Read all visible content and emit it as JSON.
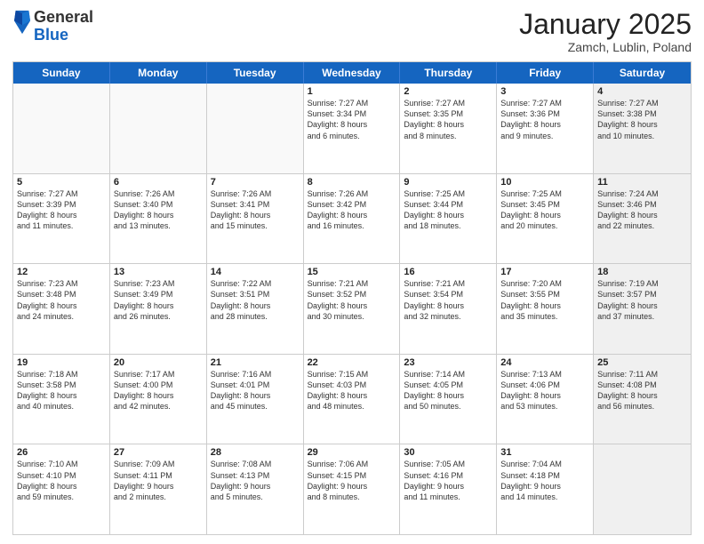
{
  "logo": {
    "general": "General",
    "blue": "Blue"
  },
  "title": "January 2025",
  "subtitle": "Zamch, Lublin, Poland",
  "headers": [
    "Sunday",
    "Monday",
    "Tuesday",
    "Wednesday",
    "Thursday",
    "Friday",
    "Saturday"
  ],
  "weeks": [
    [
      {
        "day": "",
        "info": "",
        "empty": true
      },
      {
        "day": "",
        "info": "",
        "empty": true
      },
      {
        "day": "",
        "info": "",
        "empty": true
      },
      {
        "day": "1",
        "info": "Sunrise: 7:27 AM\nSunset: 3:34 PM\nDaylight: 8 hours\nand 6 minutes."
      },
      {
        "day": "2",
        "info": "Sunrise: 7:27 AM\nSunset: 3:35 PM\nDaylight: 8 hours\nand 8 minutes."
      },
      {
        "day": "3",
        "info": "Sunrise: 7:27 AM\nSunset: 3:36 PM\nDaylight: 8 hours\nand 9 minutes."
      },
      {
        "day": "4",
        "info": "Sunrise: 7:27 AM\nSunset: 3:38 PM\nDaylight: 8 hours\nand 10 minutes.",
        "shaded": true
      }
    ],
    [
      {
        "day": "5",
        "info": "Sunrise: 7:27 AM\nSunset: 3:39 PM\nDaylight: 8 hours\nand 11 minutes."
      },
      {
        "day": "6",
        "info": "Sunrise: 7:26 AM\nSunset: 3:40 PM\nDaylight: 8 hours\nand 13 minutes."
      },
      {
        "day": "7",
        "info": "Sunrise: 7:26 AM\nSunset: 3:41 PM\nDaylight: 8 hours\nand 15 minutes."
      },
      {
        "day": "8",
        "info": "Sunrise: 7:26 AM\nSunset: 3:42 PM\nDaylight: 8 hours\nand 16 minutes."
      },
      {
        "day": "9",
        "info": "Sunrise: 7:25 AM\nSunset: 3:44 PM\nDaylight: 8 hours\nand 18 minutes."
      },
      {
        "day": "10",
        "info": "Sunrise: 7:25 AM\nSunset: 3:45 PM\nDaylight: 8 hours\nand 20 minutes."
      },
      {
        "day": "11",
        "info": "Sunrise: 7:24 AM\nSunset: 3:46 PM\nDaylight: 8 hours\nand 22 minutes.",
        "shaded": true
      }
    ],
    [
      {
        "day": "12",
        "info": "Sunrise: 7:23 AM\nSunset: 3:48 PM\nDaylight: 8 hours\nand 24 minutes."
      },
      {
        "day": "13",
        "info": "Sunrise: 7:23 AM\nSunset: 3:49 PM\nDaylight: 8 hours\nand 26 minutes."
      },
      {
        "day": "14",
        "info": "Sunrise: 7:22 AM\nSunset: 3:51 PM\nDaylight: 8 hours\nand 28 minutes."
      },
      {
        "day": "15",
        "info": "Sunrise: 7:21 AM\nSunset: 3:52 PM\nDaylight: 8 hours\nand 30 minutes."
      },
      {
        "day": "16",
        "info": "Sunrise: 7:21 AM\nSunset: 3:54 PM\nDaylight: 8 hours\nand 32 minutes."
      },
      {
        "day": "17",
        "info": "Sunrise: 7:20 AM\nSunset: 3:55 PM\nDaylight: 8 hours\nand 35 minutes."
      },
      {
        "day": "18",
        "info": "Sunrise: 7:19 AM\nSunset: 3:57 PM\nDaylight: 8 hours\nand 37 minutes.",
        "shaded": true
      }
    ],
    [
      {
        "day": "19",
        "info": "Sunrise: 7:18 AM\nSunset: 3:58 PM\nDaylight: 8 hours\nand 40 minutes."
      },
      {
        "day": "20",
        "info": "Sunrise: 7:17 AM\nSunset: 4:00 PM\nDaylight: 8 hours\nand 42 minutes."
      },
      {
        "day": "21",
        "info": "Sunrise: 7:16 AM\nSunset: 4:01 PM\nDaylight: 8 hours\nand 45 minutes."
      },
      {
        "day": "22",
        "info": "Sunrise: 7:15 AM\nSunset: 4:03 PM\nDaylight: 8 hours\nand 48 minutes."
      },
      {
        "day": "23",
        "info": "Sunrise: 7:14 AM\nSunset: 4:05 PM\nDaylight: 8 hours\nand 50 minutes."
      },
      {
        "day": "24",
        "info": "Sunrise: 7:13 AM\nSunset: 4:06 PM\nDaylight: 8 hours\nand 53 minutes."
      },
      {
        "day": "25",
        "info": "Sunrise: 7:11 AM\nSunset: 4:08 PM\nDaylight: 8 hours\nand 56 minutes.",
        "shaded": true
      }
    ],
    [
      {
        "day": "26",
        "info": "Sunrise: 7:10 AM\nSunset: 4:10 PM\nDaylight: 8 hours\nand 59 minutes."
      },
      {
        "day": "27",
        "info": "Sunrise: 7:09 AM\nSunset: 4:11 PM\nDaylight: 9 hours\nand 2 minutes."
      },
      {
        "day": "28",
        "info": "Sunrise: 7:08 AM\nSunset: 4:13 PM\nDaylight: 9 hours\nand 5 minutes."
      },
      {
        "day": "29",
        "info": "Sunrise: 7:06 AM\nSunset: 4:15 PM\nDaylight: 9 hours\nand 8 minutes."
      },
      {
        "day": "30",
        "info": "Sunrise: 7:05 AM\nSunset: 4:16 PM\nDaylight: 9 hours\nand 11 minutes."
      },
      {
        "day": "31",
        "info": "Sunrise: 7:04 AM\nSunset: 4:18 PM\nDaylight: 9 hours\nand 14 minutes."
      },
      {
        "day": "",
        "info": "",
        "empty": true,
        "shaded": true
      }
    ]
  ]
}
